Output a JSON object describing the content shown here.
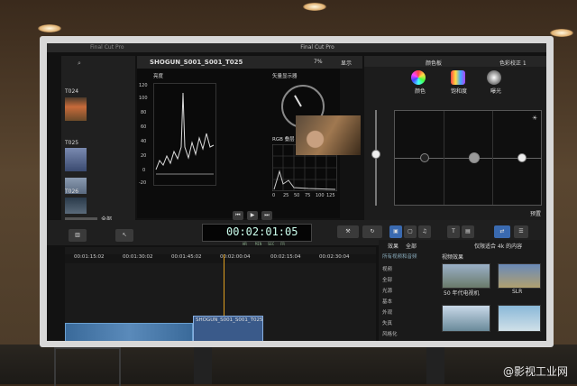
{
  "app": {
    "title": "Final Cut Pro",
    "menu_app": "Final Cut Pro"
  },
  "library": {
    "search_icon": "search-icon",
    "clips": [
      "T024",
      "T025",
      "T026"
    ],
    "filter_label": "全部"
  },
  "viewer": {
    "clip_name": "SHOGUN_S001_S001_T025",
    "display_label": "显示",
    "zoom": "7%",
    "zoom_display_label": "显示"
  },
  "scopes": {
    "waveform": {
      "title": "亮度",
      "ticks": [
        "120",
        "100",
        "80",
        "60",
        "40",
        "20",
        "0",
        "-20"
      ]
    },
    "vectorscope": {
      "title": "矢量显示器"
    },
    "rgb_histogram": {
      "title": "RGB 叠层",
      "x_ticks": [
        "0",
        "25",
        "50",
        "75",
        "100",
        "125"
      ]
    }
  },
  "inspector": {
    "tab_label": "颜色板",
    "correction": "色彩校正 1",
    "tabs": [
      {
        "label": "颜色",
        "color": "#6a4ad0"
      },
      {
        "label": "饱和度",
        "color": "#d84a8a"
      },
      {
        "label": "曝光",
        "color": "#d0d0d0"
      }
    ],
    "preset_label": "预置"
  },
  "timecode": {
    "value": "00:02:01:05",
    "sub": [
      "HR",
      "MIN",
      "SEC",
      "FR"
    ]
  },
  "timeline": {
    "ruler": [
      "00:01:15:02",
      "00:01:30:02",
      "00:01:45:02",
      "00:02:00:04",
      "00:02:15:04",
      "00:02:30:04"
    ],
    "clip_label": "SHOGUN_S001_S001_T025"
  },
  "effects_browser": {
    "header_label": "效果",
    "filter": "全部",
    "search_hint": "仅限适合 4k 的内容",
    "categories": [
      "所有视频和音频",
      "视频",
      "全部",
      "光源",
      "基本",
      "外观",
      "失真",
      "风格化"
    ],
    "section": "视频效果",
    "effect_names": [
      "50 年代电视机",
      "SLR"
    ]
  },
  "watermark": "@影视工业网"
}
